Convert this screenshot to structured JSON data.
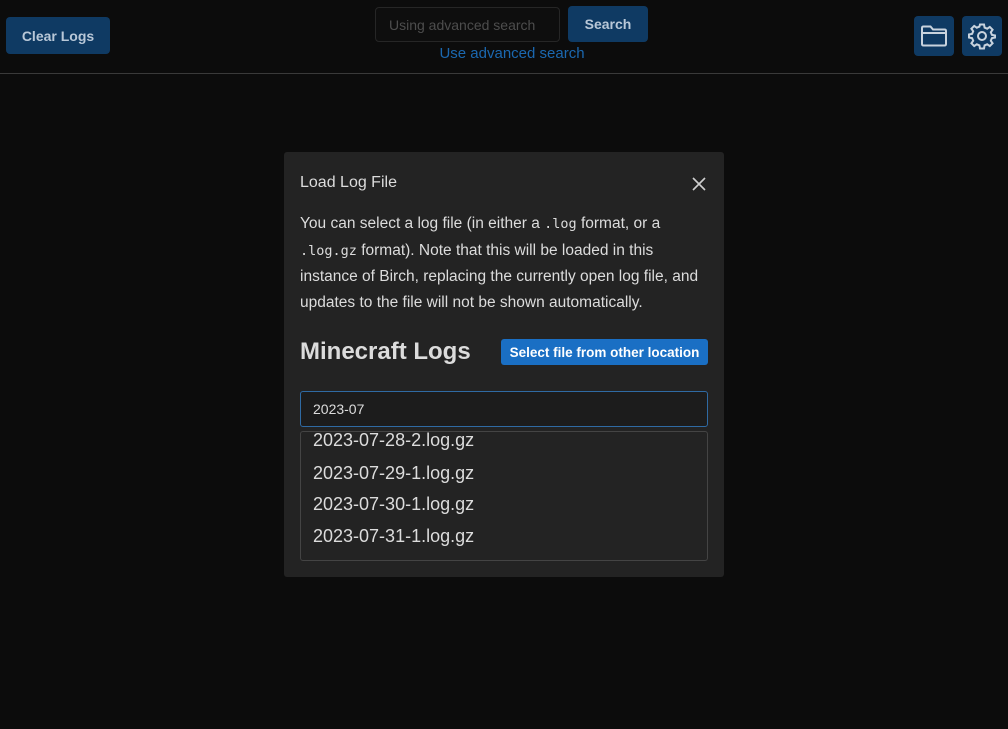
{
  "toolbar": {
    "clear_logs_label": "Clear Logs",
    "search_placeholder": "Using advanced search",
    "search_label": "Search",
    "advanced_search_link": "Use advanced search",
    "folder_icon": "folder-icon",
    "settings_icon": "gear-icon"
  },
  "modal": {
    "title": "Load Log File",
    "close_icon": "close-icon",
    "description": {
      "part1": "You can select a log file (in either a ",
      "code1": ".log",
      "part2": " format, or a ",
      "code2": ".log.gz",
      "part3": " format). Note that this will be loaded in this instance of Birch, replacing the currently open log file, and updates to the file will not be shown automatically."
    },
    "section_title": "Minecraft Logs",
    "select_other_label": "Select file from other location",
    "filter_value": "2023-07",
    "files": [
      "2023-07-28-2.log.gz",
      "2023-07-29-1.log.gz",
      "2023-07-30-1.log.gz",
      "2023-07-31-1.log.gz"
    ]
  },
  "colors": {
    "background": "#0c0c0c",
    "modal_background": "#232323",
    "button_dark_blue": "#0f3a63",
    "button_bright_blue": "#1a6fc4",
    "link_blue": "#1b68b0"
  }
}
